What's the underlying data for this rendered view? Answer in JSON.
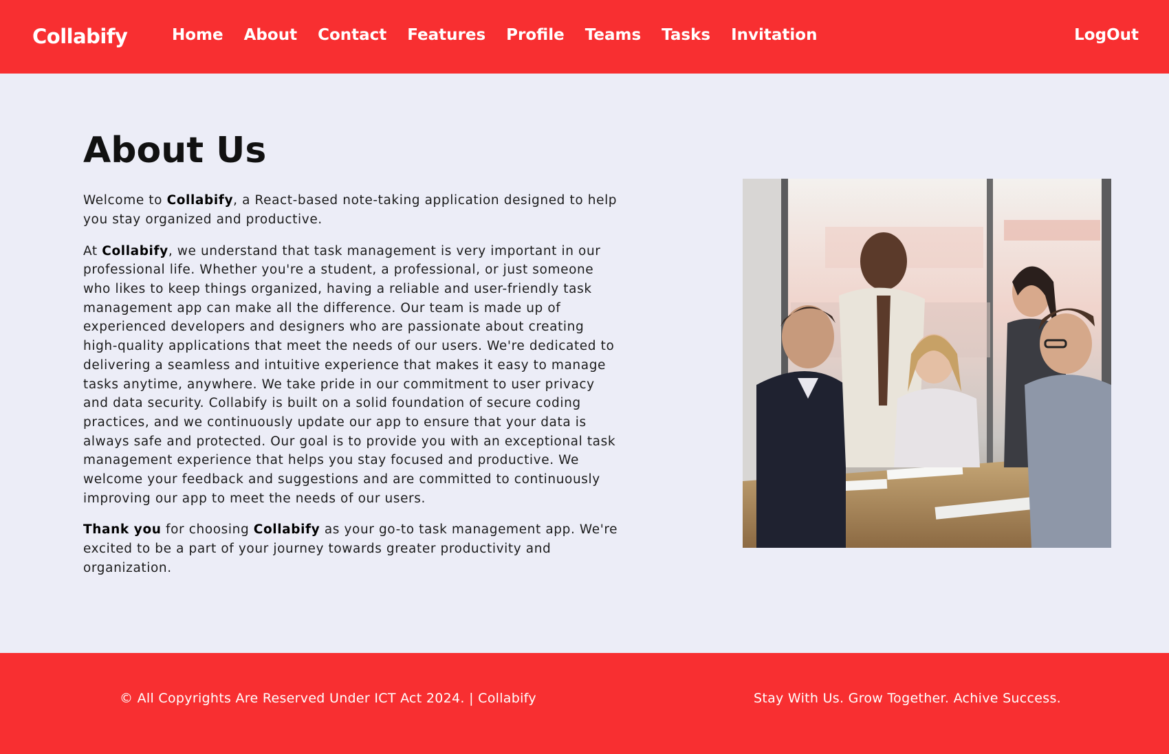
{
  "nav": {
    "brand": "Collabify",
    "links": [
      "Home",
      "About",
      "Contact",
      "Features",
      "Profile",
      "Teams",
      "Tasks",
      "Invitation"
    ],
    "logout": "LogOut"
  },
  "about": {
    "title": "About Us",
    "brand_name": "Collabify",
    "p1_a": "Welcome to ",
    "p1_b": ", a React-based note-taking application designed to help you stay organized and productive.",
    "p2_a": "At ",
    "p2_b": ", we understand that task management is very important in our professional life. Whether you're a student, a professional, or just someone who likes to keep things organized, having a reliable and user-friendly task management app can make all the difference. Our team is made up of experienced developers and designers who are passionate about creating high-quality applications that meet the needs of our users. We're dedicated to delivering a seamless and intuitive experience that makes it easy to manage tasks anytime, anywhere. We take pride in our commitment to user privacy and data security. Collabify is built on a solid foundation of secure coding practices, and we continuously update our app to ensure that your data is always safe and protected. Our goal is to provide you with an exceptional task management experience that helps you stay focused and productive. We welcome your feedback and suggestions and are committed to continuously improving our app to meet the needs of our users.",
    "p3_thank": "Thank you",
    "p3_a": " for choosing ",
    "p3_b": " as your go-to task management app. We're excited to be a part of your journey towards greater productivity and organization."
  },
  "footer": {
    "copyright": "© All Copyrights Are Reserved Under ICT Act 2024. | Collabify",
    "tagline": "Stay With Us. Grow Together. Achive Success."
  },
  "colors": {
    "brand_red": "#F82F31",
    "page_bg": "#ECEDF7",
    "text": "#1a1a1a"
  }
}
